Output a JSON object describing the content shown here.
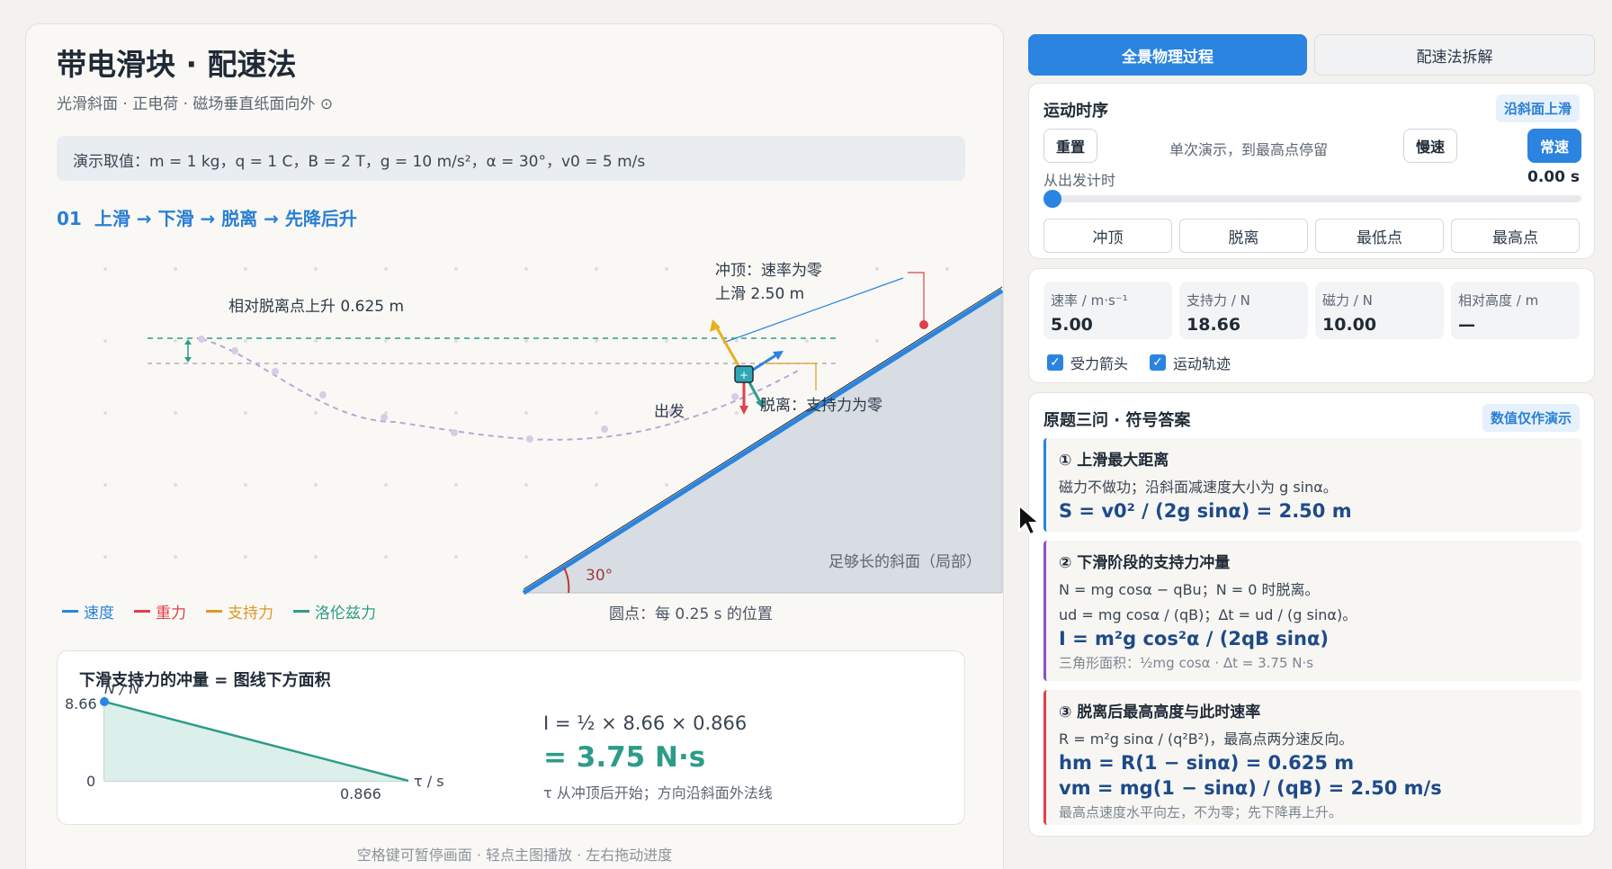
{
  "left": {
    "title": "带电滑块 · 配速法",
    "subtitle": "光滑斜面 · 正电荷 · 磁场垂直纸面向外 ⊙",
    "values_prefix": "演示取值：",
    "values_body": "m = 1 kg，q = 1 C，B = 2 T，g = 10 m/s²，α = 30°，v0 = 5 m/s",
    "section_num": "01",
    "section_title": "上滑 → 下滑 → 脱离 → 先降后升"
  },
  "scene": {
    "rise_label": "相对脱离点上升 0.625 m",
    "top_label": "冲顶：速率为零",
    "slide_up_label": "上滑 2.50 m",
    "start_label": "出发",
    "detach_label": "脱离：支持力为零",
    "slope_label": "足够长的斜面（局部）",
    "angle_label": "30°",
    "slope_angle_deg": 30
  },
  "legend": {
    "items": [
      {
        "label": "速度",
        "color": "#2a84e0"
      },
      {
        "label": "重力",
        "color": "#e0404a"
      },
      {
        "label": "支持力",
        "color": "#d99a2a"
      },
      {
        "label": "洛伦兹力",
        "color": "#2c9c8a"
      }
    ],
    "dots_note": "圆点：每 0.25 s 的位置"
  },
  "impulse": {
    "title": "下滑支持力的冲量 = 图线下方面积",
    "y_axis_label": "N / N",
    "x_axis_label": "τ / s",
    "y_max_label": "8.66",
    "y_zero_label": "0",
    "x_end_label": "0.866",
    "formula": "I = ½ × 8.66 × 0.866",
    "result": "= 3.75 N·s",
    "note": "τ 从冲顶后开始；方向沿斜面外法线"
  },
  "chart_data": {
    "type": "area",
    "x": [
      0,
      0.866
    ],
    "y": [
      8.66,
      0
    ],
    "title": "下滑支持力的冲量 = 图线下方面积",
    "xlabel": "τ / s",
    "ylabel": "N / N",
    "xlim": [
      0,
      0.866
    ],
    "ylim": [
      0,
      8.66
    ]
  },
  "footer": "空格键可暂停画面 · 轻点主图播放 · 左右拖动进度",
  "tabs": {
    "active": "全景物理过程",
    "inactive": "配速法拆解"
  },
  "timing": {
    "title": "运动时序",
    "badge": "沿斜面上滑",
    "reset": "重置",
    "mode_text": "单次演示，到最高点停留",
    "slow": "慢速",
    "normal": "常速",
    "timer_label": "从出发计时",
    "timer_value": "0.00 s",
    "progress": 0,
    "jumps": [
      "冲顶",
      "脱离",
      "最低点",
      "最高点"
    ]
  },
  "readouts": [
    {
      "label": "速率 / m·s⁻¹",
      "value": "5.00"
    },
    {
      "label": "支持力 / N",
      "value": "18.66"
    },
    {
      "label": "磁力 / N",
      "value": "10.00"
    },
    {
      "label": "相对高度 / m",
      "value": "—"
    }
  ],
  "checks": {
    "forces": "受力箭头",
    "trail": "运动轨迹"
  },
  "answers": {
    "title": "原题三问 · 符号答案",
    "badge": "数值仅作演示",
    "q1": {
      "title": "① 上滑最大距离",
      "line1": "磁力不做功；沿斜面减速度大小为 g sinα。",
      "result": "S = v0² / (2g sinα) = 2.50 m"
    },
    "q2": {
      "title": "② 下滑阶段的支持力冲量",
      "line1": "N = mg cosα − qBu；N = 0 时脱离。",
      "line2": "ud = mg cosα / (qB)；Δt = ud / (g sinα)。",
      "result": "I = m²g cos²α / (2qB sinα)",
      "note": "三角形面积：½mg cosα · Δt = 3.75 N·s"
    },
    "q3": {
      "title": "③ 脱离后最高高度与此时速率",
      "line1": "R = m²g sinα / (q²B²)，最高点两分速反向。",
      "result1": "hm = R(1 − sinα) = 0.625 m",
      "result2": "vm = mg(1 − sinα) / (qB) = 2.50 m/s",
      "note": "最高点速度水平向左，不为零；先下降再上升。"
    }
  }
}
